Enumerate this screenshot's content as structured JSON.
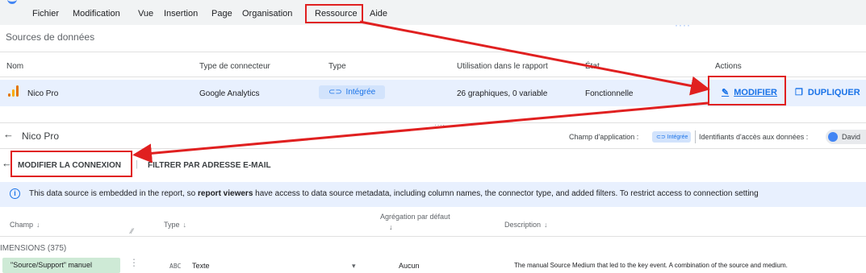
{
  "menu": {
    "items": [
      "Fichier",
      "Modification",
      "Vue",
      "Insertion",
      "Page",
      "Organisation",
      "Ressource",
      "Aide"
    ]
  },
  "sources": {
    "title": "Sources de données",
    "headers": {
      "name": "Nom",
      "connector": "Type de connecteur",
      "type": "Type",
      "usage": "Utilisation dans le rapport",
      "state": "État",
      "actions": "Actions"
    },
    "row": {
      "name": "Nico Pro",
      "connector": "Google Analytics",
      "type": "Intégrée",
      "usage": "26 graphiques, 0 variable",
      "state": "Fonctionnelle"
    },
    "actions": {
      "modify": "MODIFIER",
      "duplicate": "DUPLIQUER"
    }
  },
  "editor": {
    "back_arrow": "←",
    "title": "Nico Pro",
    "scope_label": "Champ d'application :",
    "scope_value": "Intégrée",
    "credentials_label": "Identifiants d'accès aux données :",
    "user_name": "David",
    "tabs": {
      "edit_connection": "MODIFIER LA CONNEXION",
      "filter_email": "FILTRER PAR ADRESSE E-MAIL"
    },
    "info_prefix": "This data source is embedded in the report, so ",
    "info_bold": "report viewers",
    "info_suffix": " have access to data source metadata, including column names, the connector type, and added filters. To restrict access to connection setting",
    "columns": {
      "field": "Champ",
      "type": "Type",
      "aggregation": "Agrégation par défaut",
      "description": "Description"
    },
    "dimensions_label": "IMENSIONS (375)",
    "field_row": {
      "name": "\"Source/Support\" manuel",
      "type_code": "ABC",
      "type": "Texte",
      "aggregation": "Aucun",
      "description": "The manual Source Medium that led to the key event. A combination of the source and medium."
    }
  },
  "colors": {
    "accent": "#1a73e8",
    "highlight": "#e02020",
    "row_bg": "#e8f0fe",
    "chip_green": "#ceead6"
  },
  "icons": [
    "google-analytics-icon",
    "link-icon",
    "pencil-icon",
    "copy-icon",
    "back-arrow-icon",
    "info-icon",
    "sort-down-icon",
    "kebab-icon",
    "dropdown-caret-icon",
    "user-avatar"
  ]
}
